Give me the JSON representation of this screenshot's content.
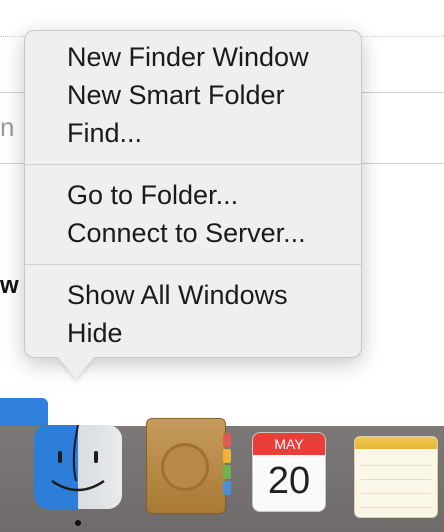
{
  "background": {
    "fragment_partial_text": "n",
    "fragment_dark_text": "w"
  },
  "context_menu": {
    "groups": [
      {
        "items": [
          "New Finder Window",
          "New Smart Folder",
          "Find..."
        ]
      },
      {
        "items": [
          "Go to Folder...",
          "Connect to Server..."
        ]
      },
      {
        "items": [
          "Show All Windows",
          "Hide"
        ]
      }
    ]
  },
  "dock": {
    "items": [
      {
        "name": "finder",
        "icon": "finder-icon",
        "running": true
      },
      {
        "name": "contacts",
        "icon": "contacts-icon"
      },
      {
        "name": "calendar",
        "icon": "calendar-icon",
        "month": "MAY",
        "day": "20"
      },
      {
        "name": "notes",
        "icon": "notes-icon"
      }
    ]
  },
  "colors": {
    "menu_bg": "#efefef",
    "calendar_red": "#ea3e38",
    "finder_blue": "#2c7ed8"
  }
}
